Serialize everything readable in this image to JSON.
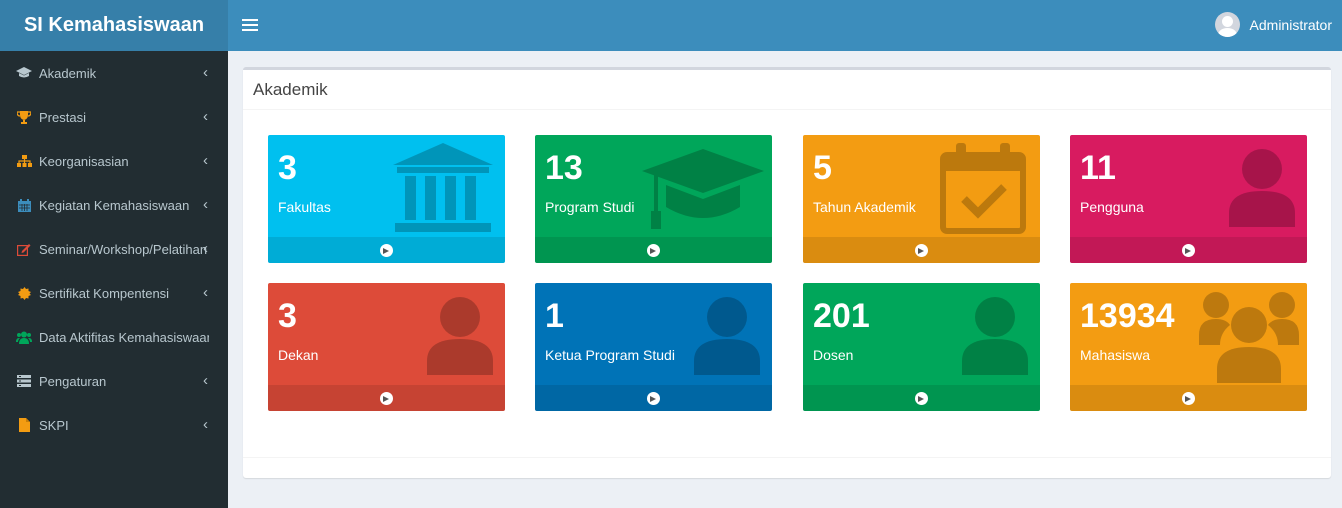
{
  "app": {
    "title": "SI Kemahasiswaan"
  },
  "header": {
    "user_name": "Administrator"
  },
  "sidebar": {
    "items": [
      {
        "label": "Akademik",
        "icon": "graduation-cap-icon",
        "color": "#b8c7ce",
        "has_submenu": true
      },
      {
        "label": "Prestasi",
        "icon": "trophy-icon",
        "color": "#f39c12",
        "has_submenu": true
      },
      {
        "label": "Keorganisasian",
        "icon": "sitemap-icon",
        "color": "#f39c12",
        "has_submenu": true
      },
      {
        "label": "Kegiatan Kemahasiswaan",
        "icon": "calendar-icon",
        "color": "#3c8dbc",
        "has_submenu": true
      },
      {
        "label": "Seminar/Workshop/Pelatihan",
        "icon": "edit-icon",
        "color": "#dd4b39",
        "has_submenu": true
      },
      {
        "label": "Sertifikat Kompentensi",
        "icon": "certificate-icon",
        "color": "#f39c12",
        "has_submenu": true
      },
      {
        "label": "Data Aktifitas Kemahasiswaan",
        "icon": "users-icon",
        "color": "#00a65a",
        "has_submenu": false
      },
      {
        "label": "Pengaturan",
        "icon": "list-icon",
        "color": "#b8c7ce",
        "has_submenu": true
      },
      {
        "label": "SKPI",
        "icon": "file-icon",
        "color": "#f39c12",
        "has_submenu": true
      }
    ]
  },
  "main": {
    "box_title": "Akademik",
    "tiles": [
      {
        "number": "3",
        "label": "Fakultas",
        "color": "#00c0ef",
        "icon": "bank-icon"
      },
      {
        "number": "13",
        "label": "Program Studi",
        "color": "#00a65a",
        "icon": "graduation-cap-icon"
      },
      {
        "number": "5",
        "label": "Tahun Akademik",
        "color": "#f39c12",
        "icon": "calendar-check-icon"
      },
      {
        "number": "11",
        "label": "Pengguna",
        "color": "#d81b60",
        "icon": "user-icon"
      },
      {
        "number": "3",
        "label": "Dekan",
        "color": "#dd4b39",
        "icon": "user-icon"
      },
      {
        "number": "1",
        "label": "Ketua Program Studi",
        "color": "#0073b7",
        "icon": "user-icon"
      },
      {
        "number": "201",
        "label": "Dosen",
        "color": "#00a65a",
        "icon": "user-icon"
      },
      {
        "number": "13934",
        "label": "Mahasiswa",
        "color": "#f39c12",
        "icon": "users-icon"
      }
    ]
  }
}
